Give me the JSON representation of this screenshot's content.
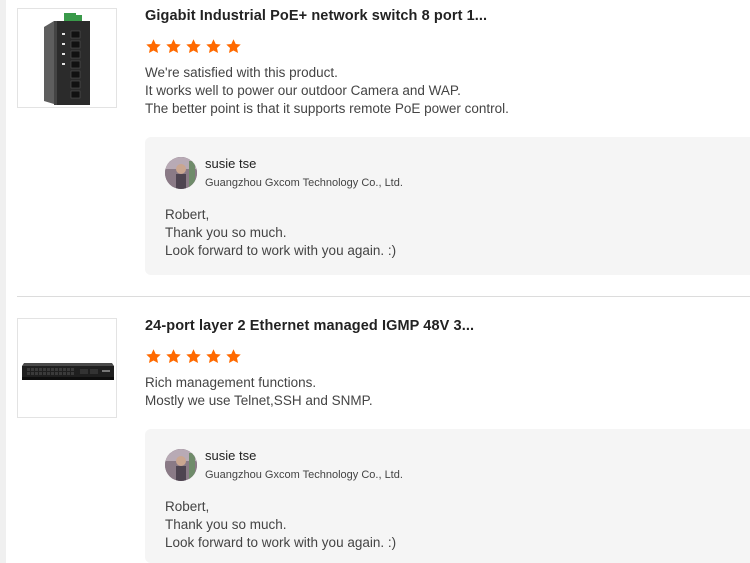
{
  "reviews": [
    {
      "product_title": "Gigabit Industrial PoE+ network switch 8 port 1...",
      "rating": 5,
      "comment": [
        "We're satisfied with this product.",
        "It works well to power our outdoor Camera and WAP.",
        "The better point is that it supports remote PoE power control."
      ],
      "reply": {
        "author": "susie tse",
        "company": "Guangzhou Gxcom Technology Co., Ltd.",
        "lines": [
          "Robert,",
          "Thank you so much.",
          "Look forward to work with you again. :)"
        ]
      }
    },
    {
      "product_title": "24-port layer 2 Ethernet managed IGMP 48V 3...",
      "rating": 5,
      "comment": [
        "Rich management functions.",
        "Mostly we use Telnet,SSH and SNMP."
      ],
      "reply": {
        "author": "susie tse",
        "company": "Guangzhou Gxcom Technology Co., Ltd.",
        "lines": [
          "Robert,",
          "Thank you so much.",
          "Look forward to work with you again. :)"
        ]
      }
    }
  ],
  "colors": {
    "star": "#ff6a00",
    "reply_bg": "#f5f5f5",
    "divider": "#dcdcdc"
  },
  "icons": {
    "star": "star-icon",
    "product_1": "din-rail-switch-image",
    "product_2": "rack-switch-image",
    "avatar": "user-avatar"
  }
}
